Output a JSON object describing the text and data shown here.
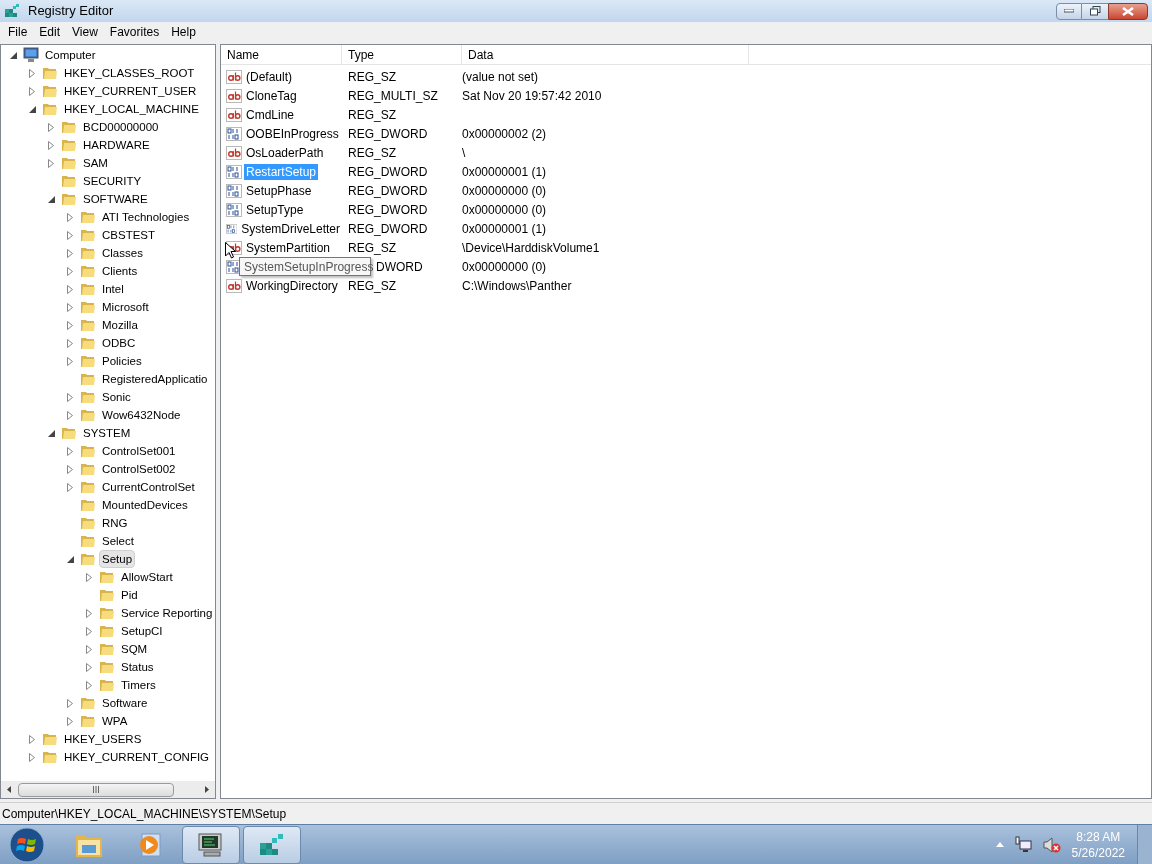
{
  "window": {
    "title": "Registry Editor"
  },
  "menu": [
    "File",
    "Edit",
    "View",
    "Favorites",
    "Help"
  ],
  "tree": [
    {
      "label": "Computer",
      "kind": "computer",
      "expanded": true,
      "selected": false,
      "children": [
        {
          "label": "HKEY_CLASSES_ROOT",
          "expanded": false,
          "selected": false
        },
        {
          "label": "HKEY_CURRENT_USER",
          "expanded": false,
          "selected": false
        },
        {
          "label": "HKEY_LOCAL_MACHINE",
          "expanded": true,
          "selected": false,
          "children": [
            {
              "label": "BCD00000000",
              "expanded": false,
              "selected": false
            },
            {
              "label": "HARDWARE",
              "expanded": false,
              "selected": false
            },
            {
              "label": "SAM",
              "expanded": false,
              "selected": false
            },
            {
              "label": "SECURITY",
              "has_subkeys": false,
              "selected": false
            },
            {
              "label": "SOFTWARE",
              "expanded": true,
              "selected": false,
              "children": [
                {
                  "label": "ATI Technologies",
                  "expanded": false,
                  "selected": false
                },
                {
                  "label": "CBSTEST",
                  "expanded": false,
                  "selected": false
                },
                {
                  "label": "Classes",
                  "expanded": false,
                  "selected": false
                },
                {
                  "label": "Clients",
                  "expanded": false,
                  "selected": false
                },
                {
                  "label": "Intel",
                  "expanded": false,
                  "selected": false
                },
                {
                  "label": "Microsoft",
                  "expanded": false,
                  "selected": false
                },
                {
                  "label": "Mozilla",
                  "expanded": false,
                  "selected": false
                },
                {
                  "label": "ODBC",
                  "expanded": false,
                  "selected": false
                },
                {
                  "label": "Policies",
                  "expanded": false,
                  "selected": false
                },
                {
                  "label": "RegisteredApplicatio",
                  "has_subkeys": false,
                  "selected": false
                },
                {
                  "label": "Sonic",
                  "expanded": false,
                  "selected": false
                },
                {
                  "label": "Wow6432Node",
                  "expanded": false,
                  "selected": false
                }
              ]
            },
            {
              "label": "SYSTEM",
              "expanded": true,
              "selected": false,
              "children": [
                {
                  "label": "ControlSet001",
                  "expanded": false,
                  "selected": false
                },
                {
                  "label": "ControlSet002",
                  "expanded": false,
                  "selected": false
                },
                {
                  "label": "CurrentControlSet",
                  "expanded": false,
                  "selected": false
                },
                {
                  "label": "MountedDevices",
                  "has_subkeys": false,
                  "selected": false
                },
                {
                  "label": "RNG",
                  "has_subkeys": false,
                  "selected": false
                },
                {
                  "label": "Select",
                  "has_subkeys": false,
                  "selected": false
                },
                {
                  "label": "Setup",
                  "expanded": true,
                  "selected": true,
                  "children": [
                    {
                      "label": "AllowStart",
                      "expanded": false,
                      "selected": false
                    },
                    {
                      "label": "Pid",
                      "has_subkeys": false,
                      "selected": false
                    },
                    {
                      "label": "Service Reporting",
                      "expanded": false,
                      "selected": false
                    },
                    {
                      "label": "SetupCI",
                      "expanded": false,
                      "selected": false
                    },
                    {
                      "label": "SQM",
                      "expanded": false,
                      "selected": false
                    },
                    {
                      "label": "Status",
                      "expanded": false,
                      "selected": false
                    },
                    {
                      "label": "Timers",
                      "expanded": false,
                      "selected": false
                    }
                  ]
                },
                {
                  "label": "Software",
                  "expanded": false,
                  "selected": false
                },
                {
                  "label": "WPA",
                  "expanded": false,
                  "selected": false
                }
              ]
            }
          ]
        },
        {
          "label": "HKEY_USERS",
          "expanded": false,
          "selected": false
        },
        {
          "label": "HKEY_CURRENT_CONFIG",
          "expanded": false,
          "selected": false
        }
      ]
    }
  ],
  "table": {
    "columns": [
      "Name",
      "Type",
      "Data"
    ],
    "rows": [
      {
        "kind": "string",
        "name": "(Default)",
        "type": "REG_SZ",
        "data": "(value not set)",
        "selected": false
      },
      {
        "kind": "string",
        "name": "CloneTag",
        "type": "REG_MULTI_SZ",
        "data": "Sat Nov 20 19:57:42 2010",
        "selected": false
      },
      {
        "kind": "string",
        "name": "CmdLine",
        "type": "REG_SZ",
        "selected": false
      },
      {
        "kind": "binary",
        "name": "OOBEInProgress",
        "type": "REG_DWORD",
        "data": "0x00000002 (2)",
        "selected": false
      },
      {
        "kind": "string",
        "name": "OsLoaderPath",
        "type": "REG_SZ",
        "data": "\\",
        "selected": false
      },
      {
        "kind": "binary",
        "name": "RestartSetup",
        "type": "REG_DWORD",
        "data": "0x00000001 (1)",
        "selected": true
      },
      {
        "kind": "binary",
        "name": "SetupPhase",
        "type": "REG_DWORD",
        "data": "0x00000000 (0)",
        "selected": false
      },
      {
        "kind": "binary",
        "name": "SetupType",
        "type": "REG_DWORD",
        "data": "0x00000000 (0)",
        "selected": false
      },
      {
        "kind": "binary",
        "name": "SystemDriveLetter",
        "type": "REG_DWORD",
        "data": "0x00000001 (1)",
        "selected": false
      },
      {
        "kind": "string",
        "name": "SystemPartition",
        "type": "REG_SZ",
        "data": "\\Device\\HarddiskVolume1",
        "selected": false
      },
      {
        "kind": "binary",
        "type": "DWORD",
        "data": "0x00000000 (0)",
        "tooltip": "SystemSetupInProgress"
      },
      {
        "kind": "string",
        "name": "WorkingDirectory",
        "type": "REG_SZ",
        "data": "C:\\Windows\\Panther",
        "selected": false
      }
    ]
  },
  "status_bar": "Computer\\HKEY_LOCAL_MACHINE\\SYSTEM\\Setup",
  "taskbar": {
    "items": [
      {
        "kind": "explorer",
        "active": false
      },
      {
        "kind": "media",
        "active": false
      },
      {
        "kind": "monitor",
        "active": true
      },
      {
        "kind": "registry",
        "active": true
      }
    ],
    "clock": {
      "time": "8:28 AM",
      "date": "5/26/2022"
    }
  }
}
